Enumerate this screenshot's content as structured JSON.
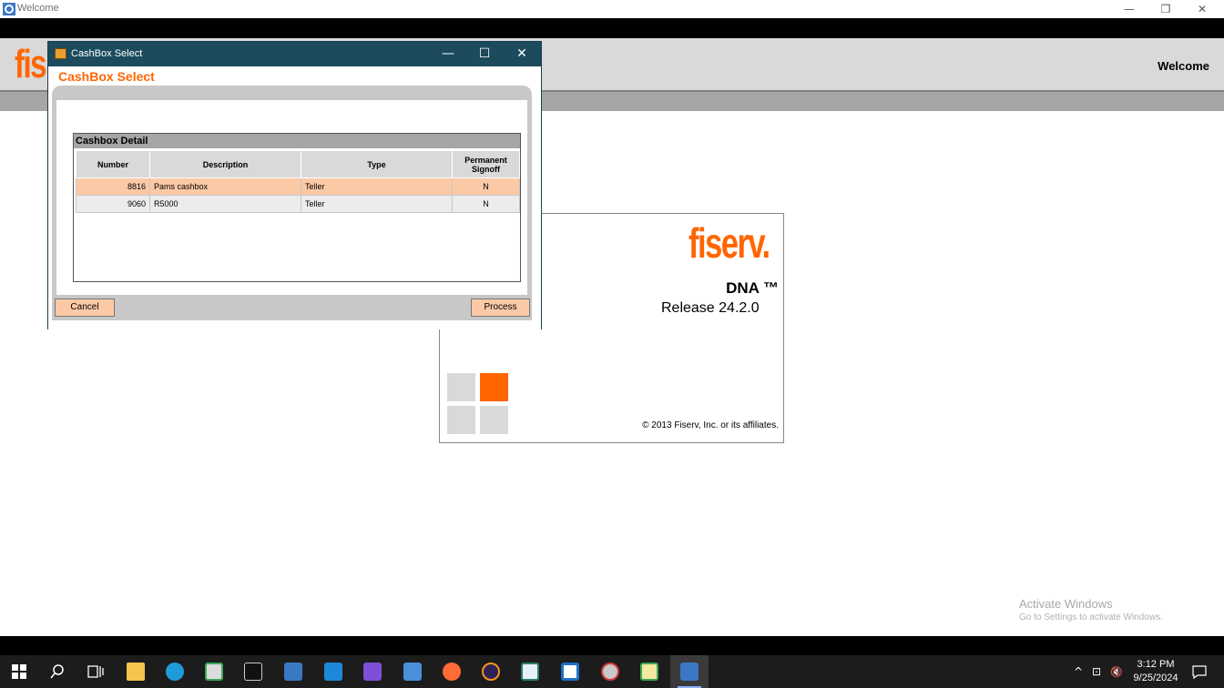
{
  "main_window": {
    "title": "Welcome",
    "controls": {
      "minimize": "—",
      "restore": "❐",
      "close": "✕"
    }
  },
  "header": {
    "logo": "fis",
    "welcome": "Welcome"
  },
  "splash": {
    "brand": "fiserv.",
    "product": "DNA ™",
    "release": "Release 24.2.0",
    "copyright": "© 2013 Fiserv, Inc. or its affiliates."
  },
  "dialog": {
    "window_title": "CashBox Select",
    "heading": "CashBox Select",
    "controls": {
      "minimize": "—",
      "maximize": "☐",
      "close": "✕"
    },
    "section_title": "Cashbox Detail",
    "columns": [
      "Number",
      "Description",
      "Type",
      "Permanent Signoff"
    ],
    "rows": [
      {
        "number": "8816",
        "description": "Pams cashbox",
        "type": "Teller",
        "signoff": "N",
        "selected": true
      },
      {
        "number": "9060",
        "description": "R5000",
        "type": "Teller",
        "signoff": "N",
        "selected": false
      }
    ],
    "cancel_label": "Cancel",
    "process_label": "Process"
  },
  "watermark": {
    "line1": "Activate Windows",
    "line2": "Go to Settings to activate Windows."
  },
  "taskbar": {
    "icons": [
      "windows-start-icon",
      "search-icon",
      "task-view-icon",
      "file-explorer-icon",
      "edge-icon",
      "app-icon",
      "terminal-icon",
      "fis-app-icon",
      "vscode-icon",
      "visual-studio-icon",
      "app-icon-2",
      "postman-icon",
      "eclipse-icon",
      "app-icon-3",
      "app-icon-4",
      "app-icon-5",
      "app-icon-6",
      "fis-app-active-icon"
    ],
    "tray": {
      "chevron": "^",
      "network": "⊡",
      "volume": "🔇"
    },
    "time": "3:12 PM",
    "date": "9/25/2024"
  }
}
